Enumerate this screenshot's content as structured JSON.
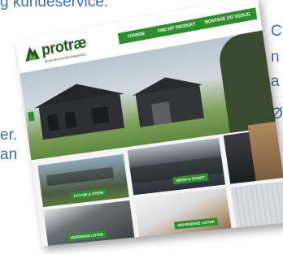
{
  "background_text": {
    "top": "g kundeservice.",
    "right": [
      "C",
      "n",
      "a",
      "Ø",
      "s"
    ],
    "left": [
      "er.",
      "an"
    ]
  },
  "site": {
    "logo_text": "protræ",
    "logo_tagline": "din professionelle træpartner",
    "nav": [
      "FORSIDE",
      "FIND DIT PRODUKT",
      "MONTAGE OG VEDLIG"
    ]
  },
  "tiles": {
    "facade": "FACADE & STERN",
    "hegn": "HEGN & STAKIT",
    "udvendige": "UDVENDIGE LISTER",
    "indvendige": "INDVENDIGE LISTER"
  },
  "colors": {
    "brand_green": "#2f8d2f",
    "text_blue": "#3a6fb0"
  }
}
